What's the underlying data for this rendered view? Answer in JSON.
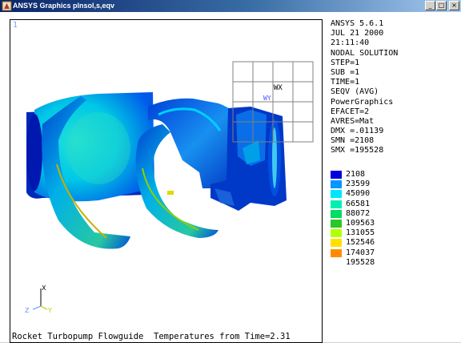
{
  "window": {
    "title": "ANSYS Graphics   plnsol,s,eqv"
  },
  "controls": {
    "minimize": "_",
    "maximize": "□",
    "close": "×"
  },
  "viewport": {
    "view_number": "1",
    "caption": "Rocket Turbopump Flowguide  Temperatures from Time=2.31",
    "workplane_label_wx": "WX",
    "workplane_label_wy": "WY"
  },
  "info": [
    "ANSYS 5.6.1",
    "JUL 21 2000",
    "21:11:40",
    "NODAL SOLUTION",
    "STEP=1",
    "SUB =1",
    "TIME=1",
    "SEQV      (AVG)",
    "PowerGraphics",
    "EFACET=2",
    "AVRES=Mat",
    "DMX =.01139",
    "SMN =2108",
    "SMX =195528"
  ],
  "legend": [
    {
      "value": "2108",
      "color": "#0000e0"
    },
    {
      "value": "23599",
      "color": "#0096ff"
    },
    {
      "value": "45090",
      "color": "#00e6ff"
    },
    {
      "value": "66581",
      "color": "#00f0b4"
    },
    {
      "value": "88072",
      "color": "#00dc64"
    },
    {
      "value": "109563",
      "color": "#28c828"
    },
    {
      "value": "131055",
      "color": "#b4ff00"
    },
    {
      "value": "152546",
      "color": "#ffe100"
    },
    {
      "value": "174037",
      "color": "#ff8c00"
    },
    {
      "value": "195528",
      "color": "#ff0000"
    }
  ],
  "triad": {
    "x": "X",
    "y": "Y",
    "z": "Z"
  }
}
